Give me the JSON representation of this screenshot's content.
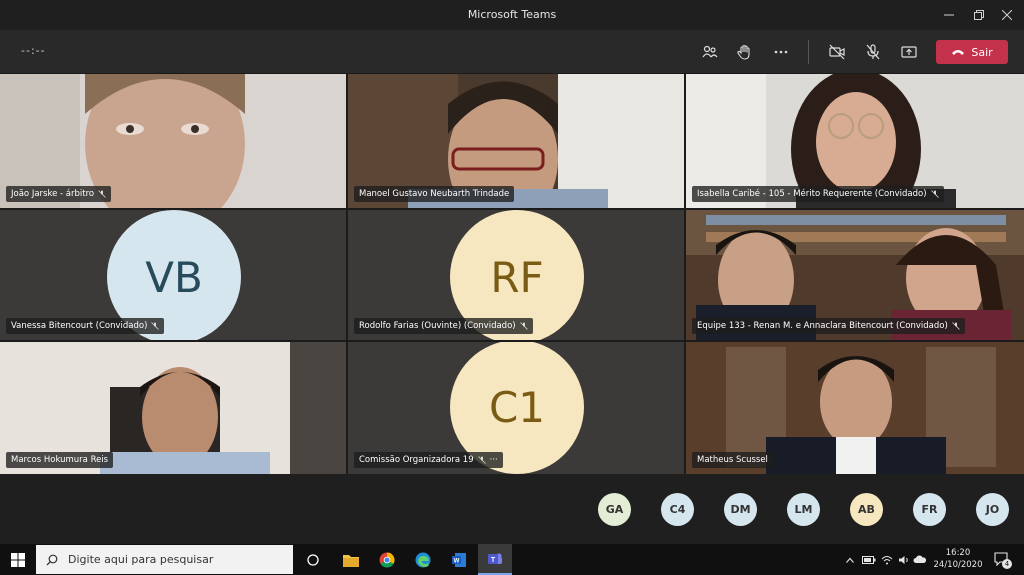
{
  "window": {
    "title": "Microsoft Teams"
  },
  "meeting": {
    "timer": "--:--",
    "leave_label": "Sair"
  },
  "tiles": [
    {
      "name": "João Jarske - árbitro",
      "type": "video"
    },
    {
      "name": "Manoel Gustavo Neubarth Trindade",
      "type": "video"
    },
    {
      "name": "Isabella Caribé - 105 - Mérito Requerente (Convidado)",
      "type": "video"
    },
    {
      "name": "Vanessa Bitencourt (Convidado)",
      "type": "avatar",
      "initials": "VB"
    },
    {
      "name": "Rodolfo Farias (Ouvinte) (Convidado)",
      "type": "avatar",
      "initials": "RF"
    },
    {
      "name": "Equipe 133 - Renan M. e Annaclara Bitencourt (Convidado)",
      "type": "video"
    },
    {
      "name": "Marcos Hokumura Reis",
      "type": "video"
    },
    {
      "name": "Comissão Organizadora 19",
      "type": "avatar",
      "initials": "C1",
      "more": "···"
    },
    {
      "name": "Matheus Scussel",
      "type": "video"
    }
  ],
  "roster": [
    "GA",
    "C4",
    "DM",
    "LM",
    "AB",
    "FR",
    "JO"
  ],
  "taskbar": {
    "search_placeholder": "Digite aqui para pesquisar",
    "time": "16:20",
    "date": "24/10/2020",
    "notification_count": "4"
  },
  "colors": {
    "leave": "#c4314b",
    "avatar_blue": "#d6e6ee",
    "avatar_cream": "#f7e7c0",
    "tile_bg": "#3b3a39"
  }
}
